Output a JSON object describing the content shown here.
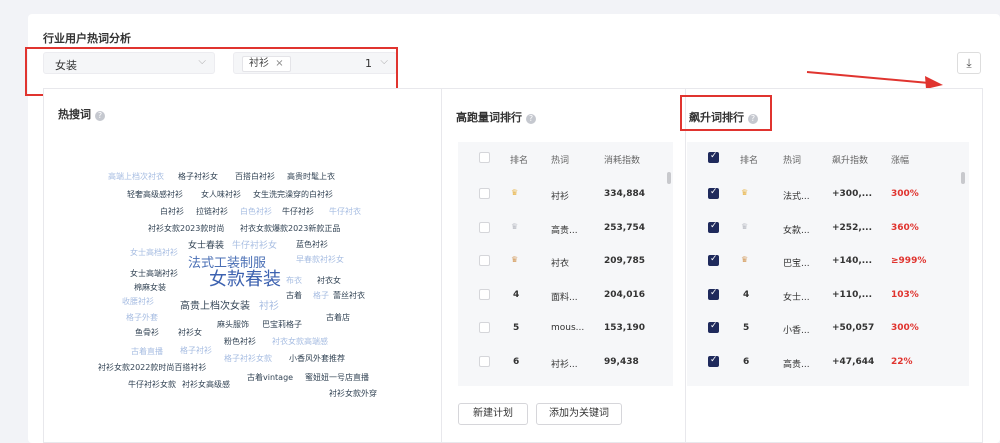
{
  "section_title": "行业用户热词分析",
  "filters": {
    "category": "女装",
    "tag": "衬衫",
    "tag_close": "×",
    "count": "1",
    "arrow": "⌵"
  },
  "download_icon": "⤓",
  "hot_words": {
    "title": "热搜词",
    "help": "?",
    "cloud": [
      {
        "t": "高端上档次衬衣",
        "c": "#a7bde2",
        "s": 8
      },
      {
        "t": "格子衬衫女",
        "c": "#345",
        "s": 8
      },
      {
        "t": "百搭白衬衫",
        "c": "#345",
        "s": 8
      },
      {
        "t": "高贵时髦上衣",
        "c": "#345",
        "s": 8
      },
      {
        "t": "轻奢高级感衬衫",
        "c": "#345",
        "s": 8
      },
      {
        "t": "女人味衬衫",
        "c": "#345",
        "s": 8
      },
      {
        "t": "女生洗完澡穿的白衬衫",
        "c": "#345",
        "s": 8
      },
      {
        "t": "白衬衫",
        "c": "#345",
        "s": 8
      },
      {
        "t": "拉链衬衫",
        "c": "#345",
        "s": 8
      },
      {
        "t": "白色衬衫",
        "c": "#a7bde2",
        "s": 8
      },
      {
        "t": "牛仔衬衫",
        "c": "#345",
        "s": 8
      },
      {
        "t": "牛仔衬衣",
        "c": "#a7bde2",
        "s": 8
      },
      {
        "t": "衬衫女款2023款时尚",
        "c": "#345",
        "s": 8
      },
      {
        "t": "衬衣女款爆款2023新款正品",
        "c": "#345",
        "s": 8
      },
      {
        "t": "女士高档衬衫",
        "c": "#a7bde2",
        "s": 8
      },
      {
        "t": "女士春装",
        "c": "#345",
        "s": 9
      },
      {
        "t": "牛仔衬衫女",
        "c": "#a7bde2",
        "s": 9
      },
      {
        "t": "蓝色衬衫",
        "c": "#345",
        "s": 8
      },
      {
        "t": "法式工装制服",
        "c": "#4a6fb5",
        "s": 13
      },
      {
        "t": "早春款衬衫女",
        "c": "#a7bde2",
        "s": 8
      },
      {
        "t": "女士高端衬衫",
        "c": "#345",
        "s": 8
      },
      {
        "t": "女款春装",
        "c": "#3d62b0",
        "s": 18
      },
      {
        "t": "布衣",
        "c": "#a7bde2",
        "s": 8
      },
      {
        "t": "衬衣女",
        "c": "#345",
        "s": 8
      },
      {
        "t": "棉麻女装",
        "c": "#345",
        "s": 8
      },
      {
        "t": "古着",
        "c": "#345",
        "s": 8
      },
      {
        "t": "格子",
        "c": "#a7bde2",
        "s": 8
      },
      {
        "t": "蕾丝衬衣",
        "c": "#345",
        "s": 8
      },
      {
        "t": "收腰衬衫",
        "c": "#a7bde2",
        "s": 8
      },
      {
        "t": "高贵上档次女装",
        "c": "#345",
        "s": 10
      },
      {
        "t": "衬衫",
        "c": "#a7bde2",
        "s": 10
      },
      {
        "t": "格子外套",
        "c": "#a7bde2",
        "s": 8
      },
      {
        "t": "古着店",
        "c": "#345",
        "s": 8
      },
      {
        "t": "麻头服饰",
        "c": "#345",
        "s": 8
      },
      {
        "t": "巴宝莉格子",
        "c": "#345",
        "s": 8
      },
      {
        "t": "鱼骨衫",
        "c": "#345",
        "s": 8
      },
      {
        "t": "衬衫女",
        "c": "#345",
        "s": 8
      },
      {
        "t": "粉色衬衫",
        "c": "#345",
        "s": 8
      },
      {
        "t": "衬衣女款高端感",
        "c": "#a7bde2",
        "s": 8
      },
      {
        "t": "古着直播",
        "c": "#a7bde2",
        "s": 8
      },
      {
        "t": "格子衬衫",
        "c": "#a7bde2",
        "s": 8
      },
      {
        "t": "格子衬衫女款",
        "c": "#a7bde2",
        "s": 8
      },
      {
        "t": "小香风外套推荐",
        "c": "#345",
        "s": 8
      },
      {
        "t": "衬衫女款2022款时尚百搭衬衫",
        "c": "#345",
        "s": 8
      },
      {
        "t": "古着vintage",
        "c": "#345",
        "s": 8
      },
      {
        "t": "蜜妞妞一号店直播",
        "c": "#345",
        "s": 8
      },
      {
        "t": "牛仔衬衫女款",
        "c": "#345",
        "s": 8
      },
      {
        "t": "衬衫女高级感",
        "c": "#345",
        "s": 8
      },
      {
        "t": "衬衫女款外穿",
        "c": "#345",
        "s": 8
      }
    ]
  },
  "volume_ranking": {
    "title": "高跑量词排行",
    "help": "?",
    "headers": [
      "排名",
      "热词",
      "消耗指数"
    ],
    "rows": [
      {
        "rank": "",
        "medal": "gold",
        "word": "衬衫",
        "value": "334,884",
        "checked": false
      },
      {
        "rank": "",
        "medal": "silver",
        "word": "高贵...",
        "value": "253,754",
        "checked": false
      },
      {
        "rank": "",
        "medal": "bronze",
        "word": "衬衣",
        "value": "209,785",
        "checked": false
      },
      {
        "rank": "4",
        "medal": "",
        "word": "面料...",
        "value": "204,016",
        "checked": false
      },
      {
        "rank": "5",
        "medal": "",
        "word": "mous...",
        "value": "153,190",
        "checked": false
      },
      {
        "rank": "6",
        "medal": "",
        "word": "衬衫...",
        "value": "99,438",
        "checked": false
      }
    ]
  },
  "rising_ranking": {
    "title": "飙升词排行",
    "help": "?",
    "headers": [
      "排名",
      "热词",
      "飙升指数",
      "涨幅"
    ],
    "rows": [
      {
        "rank": "",
        "medal": "gold",
        "word": "法式...",
        "value": "+300,...",
        "growth": "300%",
        "checked": true
      },
      {
        "rank": "",
        "medal": "silver",
        "word": "女款...",
        "value": "+252,...",
        "growth": "360%",
        "checked": true
      },
      {
        "rank": "",
        "medal": "bronze",
        "word": "巴宝...",
        "value": "+140,...",
        "growth": "≥999%",
        "checked": true
      },
      {
        "rank": "4",
        "medal": "",
        "word": "女士...",
        "value": "+110,...",
        "growth": "103%",
        "checked": true
      },
      {
        "rank": "5",
        "medal": "",
        "word": "小香...",
        "value": "+50,057",
        "growth": "300%",
        "checked": true
      },
      {
        "rank": "6",
        "medal": "",
        "word": "高贵...",
        "value": "+47,644",
        "growth": "22%",
        "checked": true
      }
    ]
  },
  "actions": {
    "new_plan": "新建计划",
    "add_keyword": "添加为关键词"
  },
  "colors": {
    "accent": "#1f2a5c",
    "growth": "#e0342f",
    "highlight": "#e0342f"
  }
}
